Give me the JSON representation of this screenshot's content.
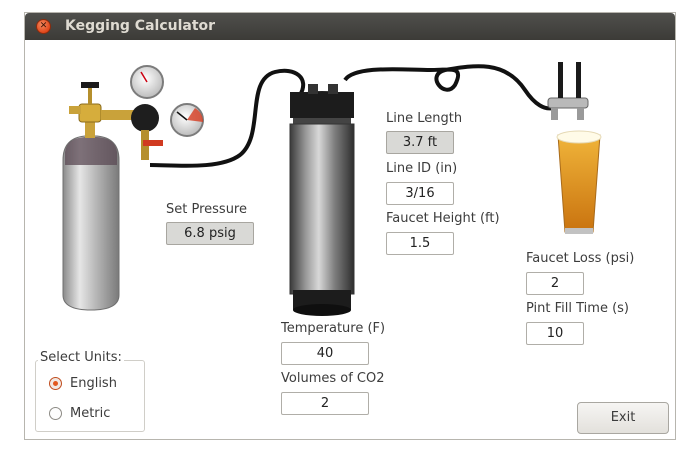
{
  "window": {
    "title": "Kegging Calculator"
  },
  "set_pressure": {
    "label": "Set Pressure",
    "value": "6.8 psig"
  },
  "line_length": {
    "label": "Line Length",
    "value": "3.7 ft"
  },
  "line_id": {
    "label": "Line ID (in)",
    "value": "3/16"
  },
  "faucet_height": {
    "label": "Faucet Height (ft)",
    "value": "1.5"
  },
  "faucet_loss": {
    "label": "Faucet Loss (psi)",
    "value": "2"
  },
  "pint_fill_time": {
    "label": "Pint Fill Time (s)",
    "value": "10"
  },
  "temperature": {
    "label": "Temperature (F)",
    "value": "40"
  },
  "volumes_co2": {
    "label": "Volumes of CO2",
    "value": "2"
  },
  "units": {
    "title": "Select Units:",
    "options": [
      {
        "label": "English",
        "selected": true
      },
      {
        "label": "Metric",
        "selected": false
      }
    ]
  },
  "buttons": {
    "exit_label": "Exit"
  },
  "colors": {
    "accent": "#e2581e",
    "titlebar": "#3c3b37"
  },
  "icons": [
    "close-icon",
    "co2-tank-image",
    "regulator-image",
    "keg-image",
    "faucet-image",
    "beer-glass-image"
  ]
}
